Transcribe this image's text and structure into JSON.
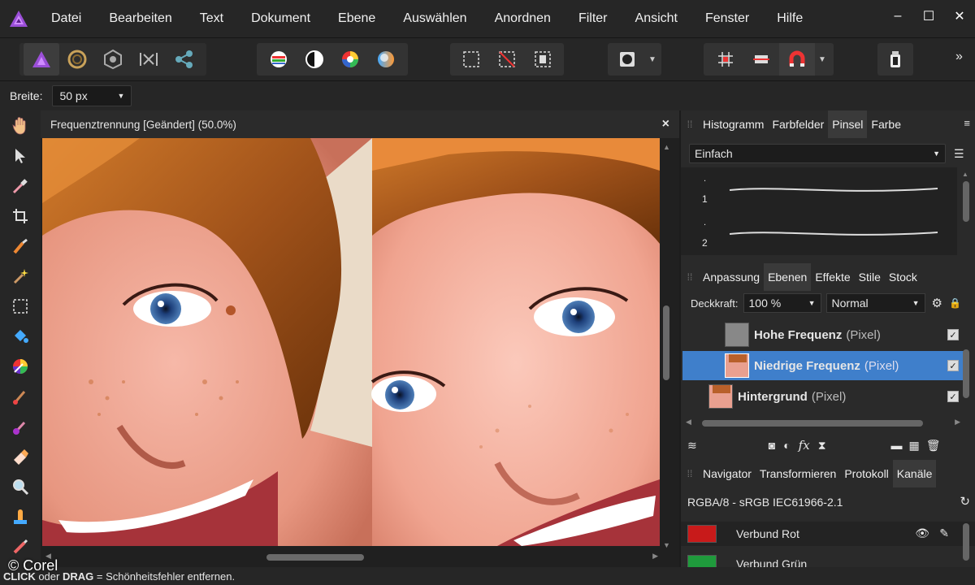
{
  "menu": {
    "items": [
      "Datei",
      "Bearbeiten",
      "Text",
      "Dokument",
      "Ebene",
      "Auswählen",
      "Anordnen",
      "Filter",
      "Ansicht",
      "Fenster",
      "Hilfe"
    ],
    "window_controls": [
      "–",
      "☐",
      "✕"
    ]
  },
  "toolbar": {
    "overflow": "»"
  },
  "context": {
    "width_label": "Breite:",
    "width_value": "50 px"
  },
  "document": {
    "title": "Frequenztrennung [Geändert] (50.0%)",
    "close": "×"
  },
  "brush_panel": {
    "tabs": [
      "Histogramm",
      "Farbfelder",
      "Pinsel",
      "Farbe"
    ],
    "active_tab": "Pinsel",
    "category": "Einfach",
    "brushes": [
      {
        "dot": ".",
        "label": "1"
      },
      {
        "dot": ".",
        "label": "2"
      }
    ]
  },
  "layers_panel": {
    "tabs": [
      "Anpassung",
      "Ebenen",
      "Effekte",
      "Stile",
      "Stock"
    ],
    "active_tab": "Ebenen",
    "opacity_label": "Deckkraft:",
    "opacity_value": "100 %",
    "blend_mode": "Normal",
    "layers": [
      {
        "name": "Hohe Frequenz",
        "type": "(Pixel)",
        "checked": "✓"
      },
      {
        "name": "Niedrige Frequenz",
        "type": "(Pixel)",
        "checked": "✓",
        "selected": true
      },
      {
        "name": "Hintergrund",
        "type": "(Pixel)",
        "checked": "✓"
      }
    ],
    "fx_label": "fx"
  },
  "channels_panel": {
    "tabs": [
      "Navigator",
      "Transformieren",
      "Protokoll",
      "Kanäle"
    ],
    "active_tab": "Kanäle",
    "profile": "RGBA/8 - sRGB IEC61966-2.1",
    "channels": [
      {
        "name": "Verbund Rot",
        "color": "#d02020"
      },
      {
        "name": "Verbund Grün",
        "color": "#20a040"
      }
    ]
  },
  "status": {
    "click": "CLICK",
    "oder": " oder ",
    "drag": "DRAG",
    "text": " = Schönheitsfehler entfernen.",
    "watermark": "© Corel"
  },
  "colors": {
    "accent": "#4a86c8",
    "selected_row": "#3d7cc9",
    "bg": "#262626"
  }
}
